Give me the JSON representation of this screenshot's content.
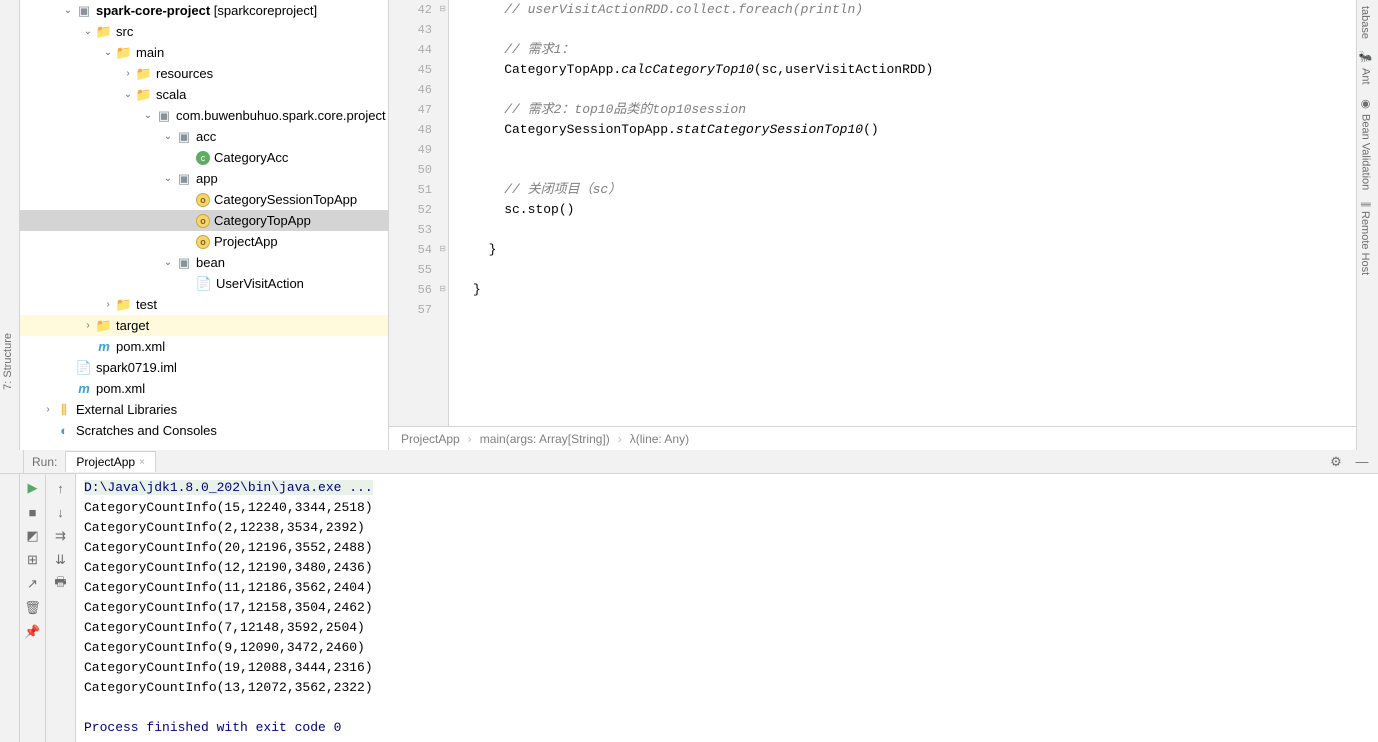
{
  "tree": {
    "project": "spark-core-project",
    "project_suffix": "[sparkcoreproject]",
    "src": "src",
    "main": "main",
    "resources": "resources",
    "scala": "scala",
    "pkg": "com.buwenbuhuo.spark.core.project",
    "acc": "acc",
    "categoryAcc": "CategoryAcc",
    "app": "app",
    "catSessionTop": "CategorySessionTopApp",
    "catTop": "CategoryTopApp",
    "projectApp": "ProjectApp",
    "bean": "bean",
    "userVisitAction": "UserVisitAction",
    "test": "test",
    "target": "target",
    "pom1": "pom.xml",
    "iml": "spark0719.iml",
    "pom2": "pom.xml",
    "extLib": "External Libraries",
    "scratches": "Scratches and Consoles"
  },
  "gutter": [
    "42",
    "43",
    "44",
    "45",
    "46",
    "47",
    "48",
    "49",
    "50",
    "51",
    "52",
    "53",
    "54",
    "55",
    "56",
    "57"
  ],
  "code": {
    "l42": "    // userVisitActionRDD.collect.foreach(println)",
    "l44": "    // 需求1：",
    "l45a": "    CategoryTopApp.",
    "l45b": "calcCategoryTop10",
    "l45c": "(sc,userVisitActionRDD)",
    "l47": "    // 需求2：top10品类的top10session",
    "l48a": "    CategorySessionTopApp.",
    "l48b": "statCategorySessionTop10",
    "l48c": "()",
    "l51": "    // 关闭项目（sc）",
    "l52": "    sc.stop()",
    "l54": "  }",
    "l56": "}"
  },
  "breadcrumb": {
    "a": "ProjectApp",
    "b": "main(args: Array[String])",
    "c": "λ(line: Any)"
  },
  "rightTools": [
    "tabase",
    "Ant",
    "Bean Validation",
    "Remote Host"
  ],
  "leftTool": "7: Structure",
  "run": {
    "label": "Run:",
    "tab": "ProjectApp",
    "cmd": "D:\\Java\\jdk1.8.0_202\\bin\\java.exe ...",
    "out": [
      "CategoryCountInfo(15,12240,3344,2518)",
      "CategoryCountInfo(2,12238,3534,2392)",
      "CategoryCountInfo(20,12196,3552,2488)",
      "CategoryCountInfo(12,12190,3480,2436)",
      "CategoryCountInfo(11,12186,3562,2404)",
      "CategoryCountInfo(17,12158,3504,2462)",
      "CategoryCountInfo(7,12148,3592,2504)",
      "CategoryCountInfo(9,12090,3472,2460)",
      "CategoryCountInfo(19,12088,3444,2316)",
      "CategoryCountInfo(13,12072,3562,2322)"
    ],
    "exit": "Process finished with exit code 0"
  }
}
